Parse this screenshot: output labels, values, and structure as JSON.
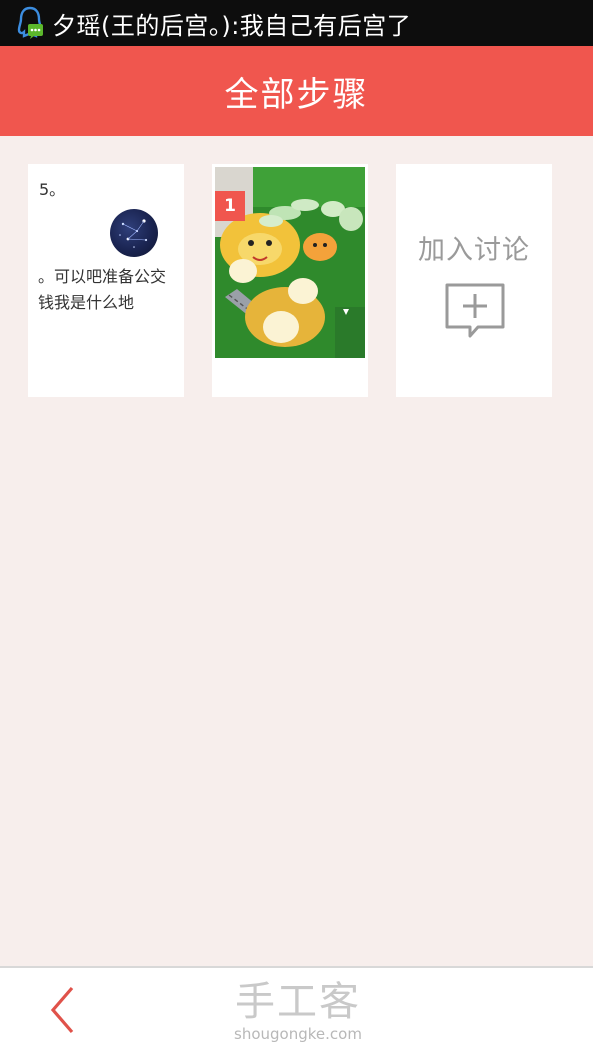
{
  "colors": {
    "accent": "#f0564e",
    "page_background": "#f7eeec",
    "status_bar_background": "#0d0d0d",
    "muted_text": "#9a9a9a"
  },
  "status_bar": {
    "notification_icon": "qq-penguin-chat-icon",
    "notification_text": "夕瑶(王的后宫。):我自己有后宫了"
  },
  "header": {
    "title": "全部步骤"
  },
  "steps": [
    {
      "number_label": "5。",
      "avatar_icon": "constellation-avatar-icon",
      "text": "。可以吧准备公交钱我是什么地"
    },
    {
      "badge": "1",
      "photo": "step-photo-food-on-cartoon-placemat"
    }
  ],
  "discussion": {
    "label": "加入讨论",
    "icon": "chat-bubble-plus-icon"
  },
  "bottom_bar": {
    "back_icon": "chevron-left-icon",
    "logo_text": "手工客",
    "logo_domain": "shougongke.com"
  }
}
